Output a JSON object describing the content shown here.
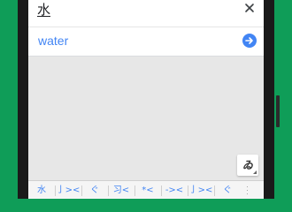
{
  "input": {
    "value": "水"
  },
  "suggestion": {
    "text": "water"
  },
  "handwriting_button": {
    "glyph": "ゐ"
  },
  "candidates": [
    "水",
    "亅><",
    "ぐ",
    "习<",
    "*<",
    "-><",
    "亅><",
    "ぐ"
  ],
  "colors": {
    "accent": "#4285f4",
    "background": "#0f9d58",
    "canvas": "#e7e7e7"
  }
}
